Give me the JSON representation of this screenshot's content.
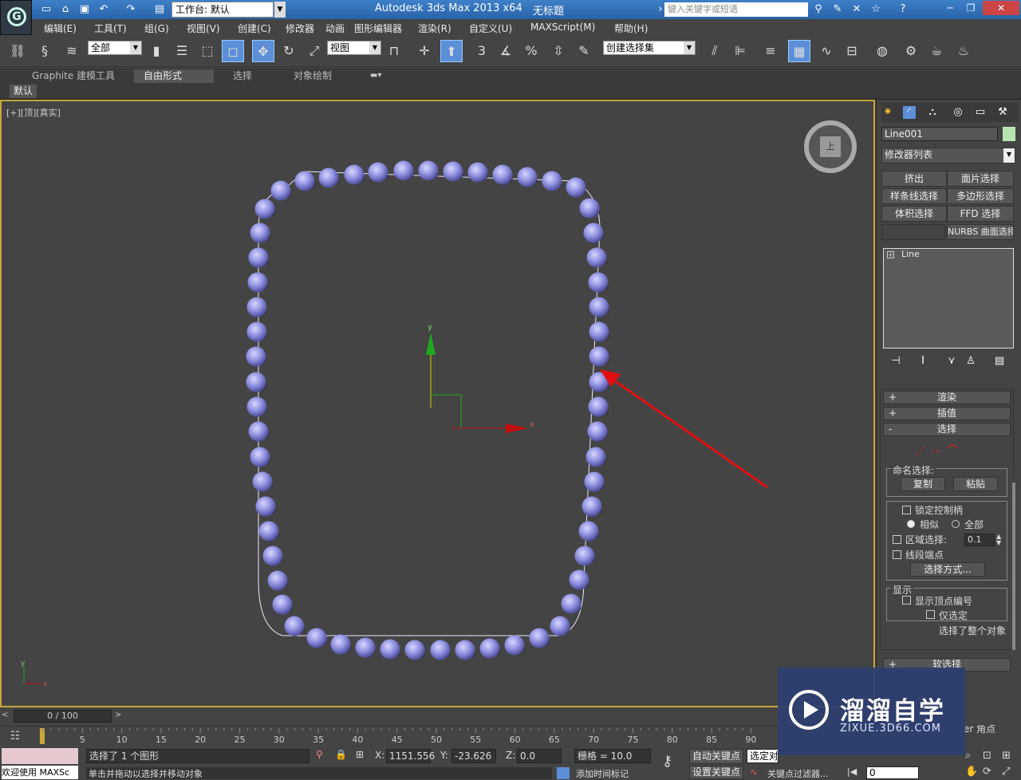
{
  "titlebar": {
    "workspace_label": "工作台: 默认",
    "app_title": "Autodesk 3ds Max  2013 x64",
    "doc_title": "无标题",
    "search_placeholder": "键入关键字或短语"
  },
  "menu": [
    "编辑(E)",
    "工具(T)",
    "组(G)",
    "视图(V)",
    "创建(C)",
    "修改器",
    "动画",
    "图形编辑器",
    "渲染(R)",
    "自定义(U)",
    "MAXScript(M)",
    "帮助(H)"
  ],
  "toolbar": {
    "filter_value": "全部",
    "refcoord_value": "视图",
    "snap_label": "3",
    "angle_label": "%",
    "named_selection_placeholder": "创建选择集"
  },
  "ribbon": {
    "tabs": [
      "Graphite 建模工具",
      "自由形式",
      "选择",
      "对象绘制"
    ],
    "active_tab": "自由形式",
    "sub_label": "默认"
  },
  "viewport": {
    "label": "[+][顶][真实]",
    "viewcube_face": "上",
    "axis_y": "y",
    "axis_x": "x",
    "mini_axis_y": "y",
    "mini_axis_x": "x",
    "bead_color": "#8f8fe0",
    "arrow_color": "#e01010"
  },
  "cmdpanel": {
    "object_name": "Line001",
    "object_color": "#b8e6b0",
    "modifier_list": "修改器列表",
    "buttons": [
      "挤出",
      "面片选择",
      "样条线选择",
      "多边形选择",
      "体积选择",
      "FFD 选择",
      "",
      "NURBS 曲面选择"
    ],
    "stack_item": "Line",
    "rollouts": {
      "render": "渲染",
      "interp": "插值",
      "select": "选择",
      "soft": "软选择"
    },
    "named_sel_title": "命名选择:",
    "copy_btn": "复制",
    "paste_btn": "粘贴",
    "lock_handles": "锁定控制柄",
    "similar": "相似",
    "all": "全部",
    "area_select": "区域选择:",
    "area_value": "0.1",
    "segment_end": "线段端点",
    "select_by": "选择方式...",
    "display_title": "显示",
    "show_vertex_num": "显示顶点编号",
    "only_selected": "仅选定",
    "status_text": "选择了整个对象",
    "partial1": "er",
    "partial2": "er 角点"
  },
  "timeline": {
    "frame_info": "0 / 100",
    "ticks": [
      "5",
      "10",
      "15",
      "20",
      "25",
      "30",
      "35",
      "40",
      "45",
      "50",
      "55",
      "60",
      "65",
      "70",
      "75",
      "80",
      "85",
      "90"
    ]
  },
  "statusbar": {
    "welcome": "欢迎使用 MAXSc",
    "selected": "选择了 1 个图形",
    "hint": "单击并拖动以选择并移动对象",
    "x_label": "X:",
    "x_value": "1151.556",
    "y_label": "Y:",
    "y_value": "-23.626",
    "z_label": "Z:",
    "z_value": "0.0",
    "grid": "栅格 = 10.0",
    "add_time_tag": "添加时间标记",
    "auto_key": "自动关键点",
    "set_key": "设置关键点",
    "selected_obj": "选定对",
    "key_filter": "关键点过滤器...",
    "frame_value": "0"
  },
  "watermark": {
    "brand": "溜溜自学",
    "url": "ZIXUE.3D66.COM"
  }
}
